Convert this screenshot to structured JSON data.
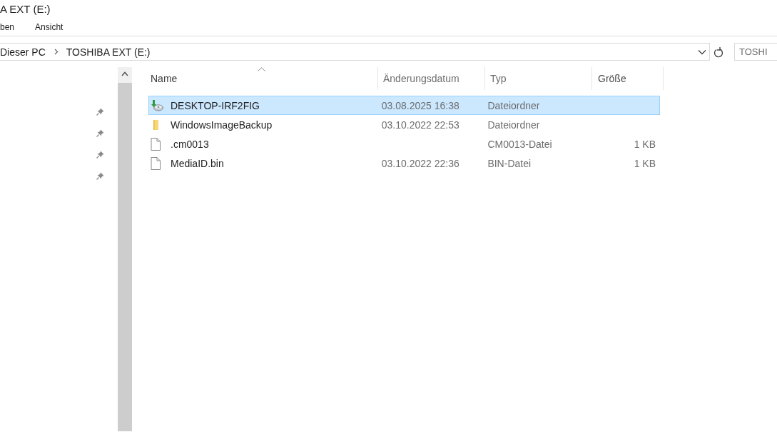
{
  "window": {
    "title": "A EXT (E:)"
  },
  "ribbon_tabs": [
    {
      "label": "ben"
    },
    {
      "label": "Ansicht"
    }
  ],
  "address_bar": {
    "path": [
      {
        "label": "Dieser PC"
      },
      {
        "label": "TOSHIBA EXT (E:)"
      }
    ]
  },
  "search": {
    "placeholder": "TOSHI"
  },
  "quick_access": [
    {
      "pinned": true
    },
    {
      "pinned": true
    },
    {
      "pinned": true
    },
    {
      "pinned": true
    }
  ],
  "file_list": {
    "columns": [
      {
        "label": "Name",
        "sorted": true
      },
      {
        "label": "Änderungsdatum",
        "sorted": false
      },
      {
        "label": "Typ",
        "sorted": false
      },
      {
        "label": "Größe",
        "sorted": false
      }
    ],
    "rows": [
      {
        "kind": "backup",
        "name": "DESKTOP-IRF2FIG",
        "date": "03.08.2025 16:38",
        "type": "Dateiordner",
        "size": "",
        "selected": true
      },
      {
        "kind": "folder",
        "name": "WindowsImageBackup",
        "date": "03.10.2022 22:53",
        "type": "Dateiordner",
        "size": "",
        "selected": false
      },
      {
        "kind": "file",
        "name": ".cm0013",
        "date": "",
        "type": "CM0013-Datei",
        "size": "1 KB",
        "selected": false
      },
      {
        "kind": "file",
        "name": "MediaID.bin",
        "date": "03.10.2022 22:36",
        "type": "BIN-Datei",
        "size": "1 KB",
        "selected": false
      }
    ]
  }
}
